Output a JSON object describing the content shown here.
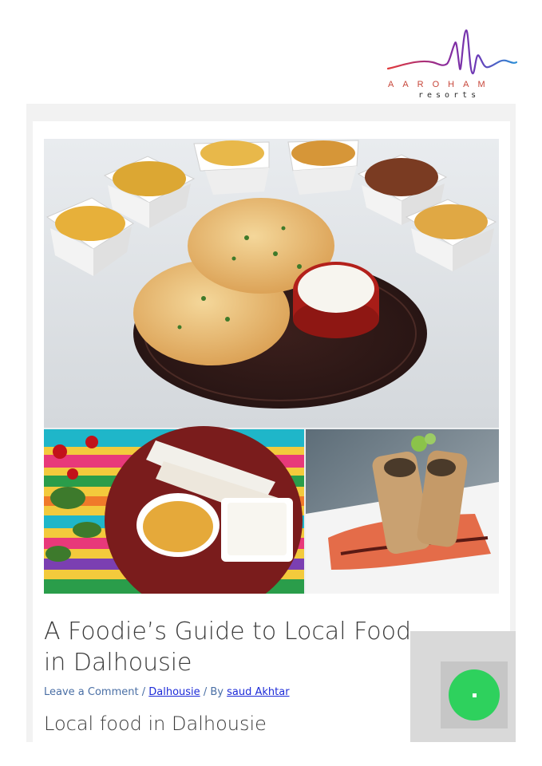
{
  "logo": {
    "brand_word": "AAROHAM",
    "brand_sub": "resorts",
    "colors": {
      "wave_left": "#e23a3a",
      "wave_mid": "#7a2ea8",
      "wave_right": "#2a8fd6",
      "word": "#c7463a"
    }
  },
  "post": {
    "title": "A Foodie’s Guide to Local Food in Dalhousie",
    "meta": {
      "comment_link": "Leave a Comment",
      "separator": "/",
      "category": "Dalhousie",
      "by_label": "By",
      "author": "saud Akhtar"
    },
    "section_heading": "Local food in Dalhousie"
  },
  "hero_image": {
    "icon": "food-collage-image"
  },
  "chat_widget": {
    "icon": "chat-bubble-icon",
    "color": "#2ed15d"
  }
}
